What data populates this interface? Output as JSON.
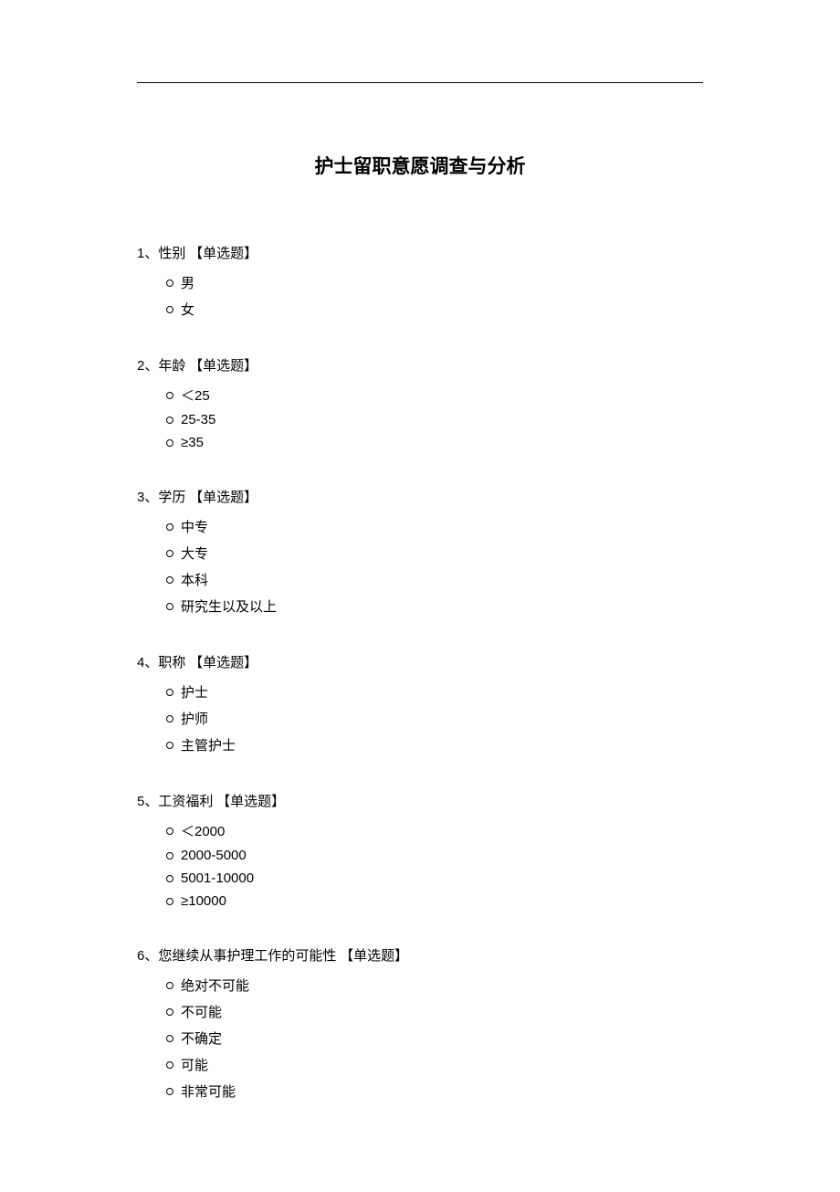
{
  "title": "护士留职意愿调查与分析",
  "type_label": "【单选题】",
  "questions": [
    {
      "num": "1、",
      "text": "性别",
      "options": [
        {
          "text": "男",
          "numeric": false
        },
        {
          "text": "女",
          "numeric": false
        }
      ]
    },
    {
      "num": "2、",
      "text": "年龄",
      "options": [
        {
          "text": "＜25",
          "numeric": true
        },
        {
          "text": "25-35",
          "numeric": true
        },
        {
          "text": "≥35",
          "numeric": true
        }
      ]
    },
    {
      "num": "3、",
      "text": "学历",
      "options": [
        {
          "text": "中专",
          "numeric": false
        },
        {
          "text": "大专",
          "numeric": false
        },
        {
          "text": "本科",
          "numeric": false
        },
        {
          "text": "研究生以及以上",
          "numeric": false
        }
      ]
    },
    {
      "num": "4、",
      "text": "职称",
      "options": [
        {
          "text": "护士",
          "numeric": false
        },
        {
          "text": "护师",
          "numeric": false
        },
        {
          "text": "主管护士",
          "numeric": false
        }
      ]
    },
    {
      "num": "5、",
      "text": "工资福利",
      "options": [
        {
          "text": "＜2000",
          "numeric": true
        },
        {
          "text": "2000-5000",
          "numeric": true
        },
        {
          "text": "5001-10000",
          "numeric": true
        },
        {
          "text": "≥10000",
          "numeric": true
        }
      ]
    },
    {
      "num": "6、",
      "text": "您继续从事护理工作的可能性",
      "options": [
        {
          "text": "绝对不可能",
          "numeric": false
        },
        {
          "text": "不可能",
          "numeric": false
        },
        {
          "text": "不确定",
          "numeric": false
        },
        {
          "text": "可能",
          "numeric": false
        },
        {
          "text": "非常可能",
          "numeric": false
        }
      ]
    }
  ]
}
